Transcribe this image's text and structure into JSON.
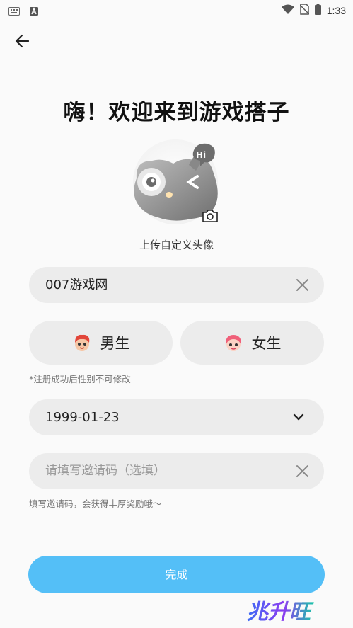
{
  "status_bar": {
    "time": "1:33"
  },
  "header": {
    "title": "嗨！欢迎来到游戏搭子"
  },
  "avatar": {
    "upload_label": "上传自定义头像",
    "bubble_text": "Hi"
  },
  "nickname": {
    "value": "007游戏网"
  },
  "gender": {
    "options": [
      {
        "label": "男生"
      },
      {
        "label": "女生"
      }
    ],
    "note": "*注册成功后性别不可修改"
  },
  "birthday": {
    "value": "1999-01-23"
  },
  "invite": {
    "placeholder": "请填写邀请码（选填）",
    "hint": "填写邀请码，会获得丰厚奖励哦～"
  },
  "submit": {
    "label": "完成"
  },
  "watermark": {
    "text": "兆升旺"
  },
  "colors": {
    "accent": "#54bff7",
    "field_bg": "#ececec",
    "page_bg": "#fafafa"
  }
}
